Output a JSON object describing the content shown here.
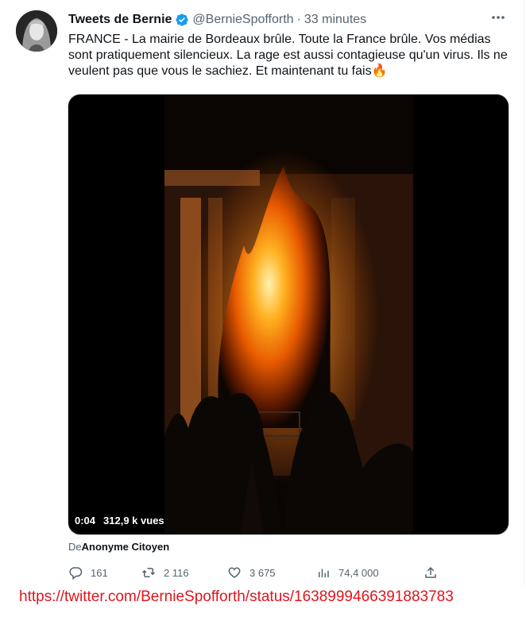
{
  "tweet": {
    "display_name": "Tweets de Bernie",
    "handle": "@BernieSpofforth",
    "separator": "·",
    "time": "33 minutes",
    "text": "FRANCE - La mairie de Bordeaux brûle. Toute la France brûle. Vos médias sont pratiquement silencieux. La rage est aussi contagieuse qu'un virus. Ils ne veulent pas que vous le sachiez. Et maintenant tu fais🔥",
    "verified_color": "#1d9bf0"
  },
  "media": {
    "timestamp": "0:04",
    "views": "312,9 k vues"
  },
  "attribution": {
    "prefix": "De",
    "source": "Anonyme Citoyen"
  },
  "actions": {
    "replies": "161",
    "retweets": "2 116",
    "likes": "3 675",
    "views": "74,4 000"
  },
  "footer": {
    "url": "https://twitter.com/BernieSpofforth/status/1638999466391883783",
    "url_color": "#e0141c"
  }
}
